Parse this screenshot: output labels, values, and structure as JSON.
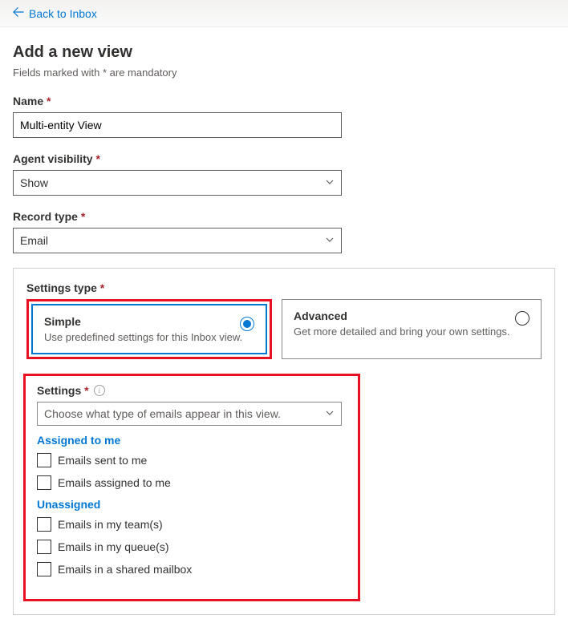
{
  "header": {
    "back_label": "Back to Inbox",
    "page_title": "Add a new view",
    "mandatory_note": "Fields marked with * are mandatory"
  },
  "fields": {
    "name": {
      "label": "Name",
      "value": "Multi-entity View"
    },
    "agent_visibility": {
      "label": "Agent visibility",
      "value": "Show"
    },
    "record_type": {
      "label": "Record type",
      "value": "Email"
    }
  },
  "settings_type": {
    "label": "Settings type",
    "simple": {
      "title": "Simple",
      "desc": "Use predefined settings for this Inbox view."
    },
    "advanced": {
      "title": "Advanced",
      "desc": "Get more detailed and bring your own settings."
    }
  },
  "settings_block": {
    "label": "Settings",
    "placeholder": "Choose what type of emails appear in this view.",
    "groups": [
      {
        "header": "Assigned to me",
        "options": [
          "Emails sent to me",
          "Emails assigned to me"
        ]
      },
      {
        "header": "Unassigned",
        "options": [
          "Emails in my team(s)",
          "Emails in my queue(s)",
          "Emails in a shared mailbox"
        ]
      }
    ]
  }
}
